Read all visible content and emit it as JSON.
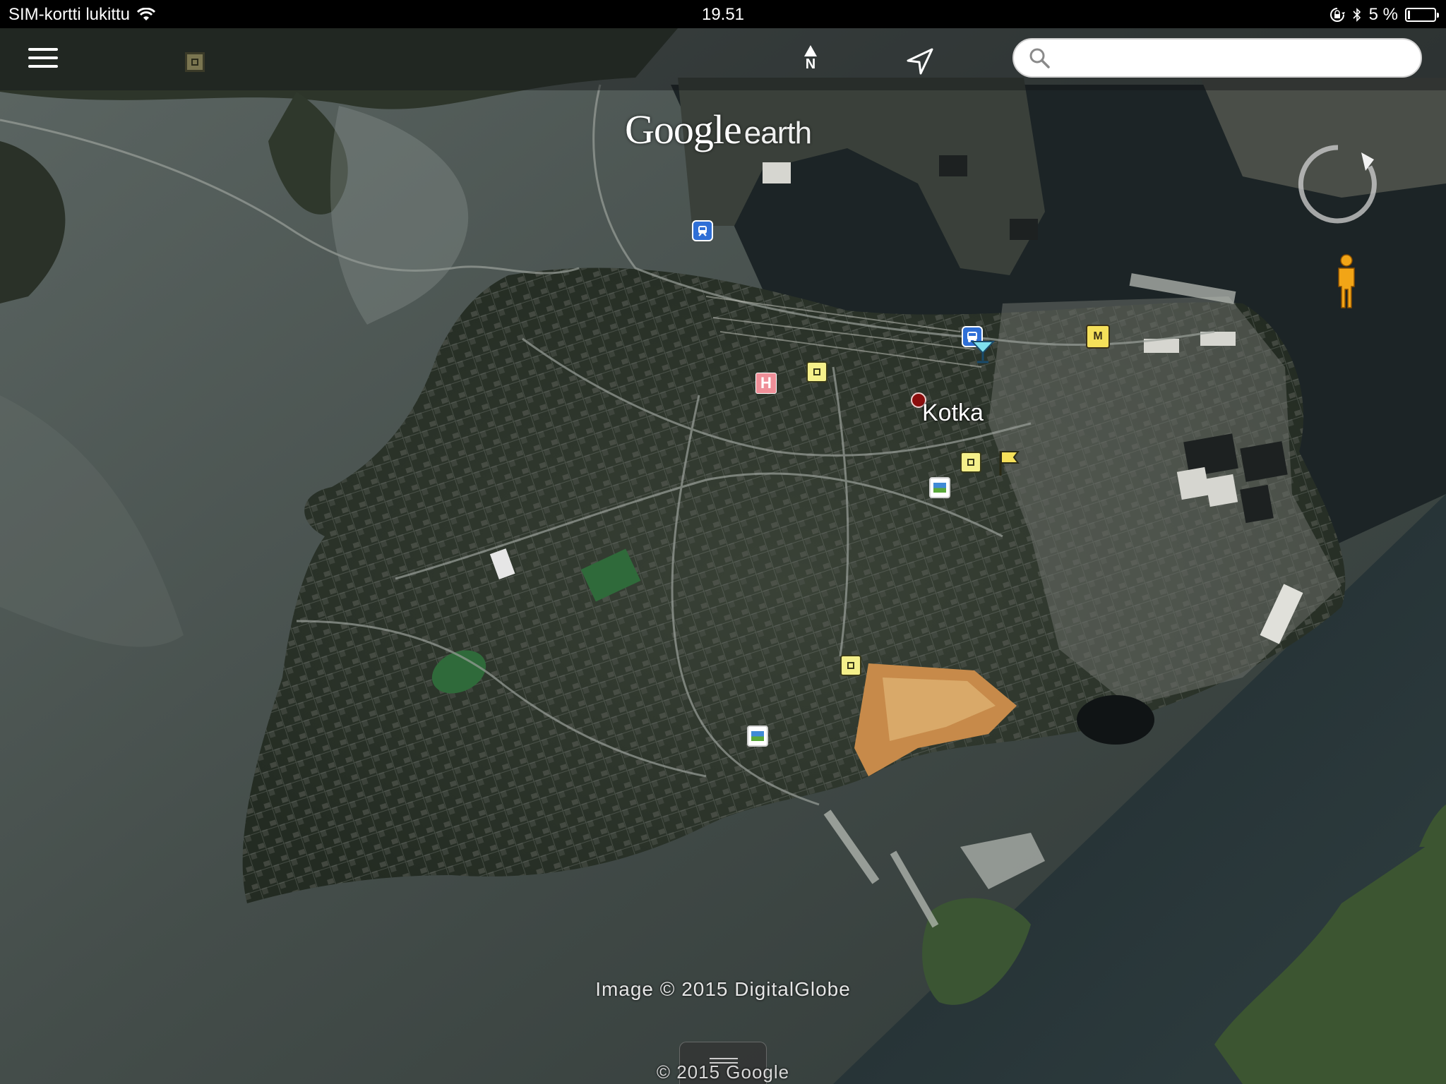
{
  "status_bar": {
    "carrier": "SIM-kortti lukittu",
    "time": "19.51",
    "battery_text": "5 %"
  },
  "toolbar": {
    "north_label": "N",
    "search_placeholder": ""
  },
  "map": {
    "logo_google": "Google",
    "logo_earth": "earth",
    "city_label": "Kotka",
    "attribution_image": "Image © 2015 DigitalGlobe",
    "attribution_google": "© 2015 Google",
    "markers": [
      {
        "name": "train-station-marker",
        "kind": "blue",
        "glyph": "⚲"
      },
      {
        "name": "bus-station-marker",
        "kind": "blue",
        "glyph": "⛟"
      },
      {
        "name": "bar-marker",
        "kind": "cocktail"
      },
      {
        "name": "museum-marker",
        "kind": "museum",
        "glyph": "M"
      },
      {
        "name": "hospital-marker",
        "kind": "h",
        "glyph": "H"
      },
      {
        "name": "place-marker",
        "kind": "square"
      },
      {
        "name": "flag-marker",
        "kind": "flag"
      },
      {
        "name": "photo-marker",
        "kind": "photo"
      }
    ]
  },
  "colors": {
    "water": "#3d4744",
    "land": "#2b3329",
    "marker_yellow": "#f5f08a",
    "marker_blue": "#2f6fd6"
  },
  "icons": [
    "menu-icon",
    "layers-icon",
    "north-arrow-icon",
    "locate-icon",
    "search-icon",
    "compass-icon",
    "pegman-icon",
    "wifi-icon",
    "orientation-lock-icon",
    "bluetooth-icon",
    "battery-icon"
  ]
}
